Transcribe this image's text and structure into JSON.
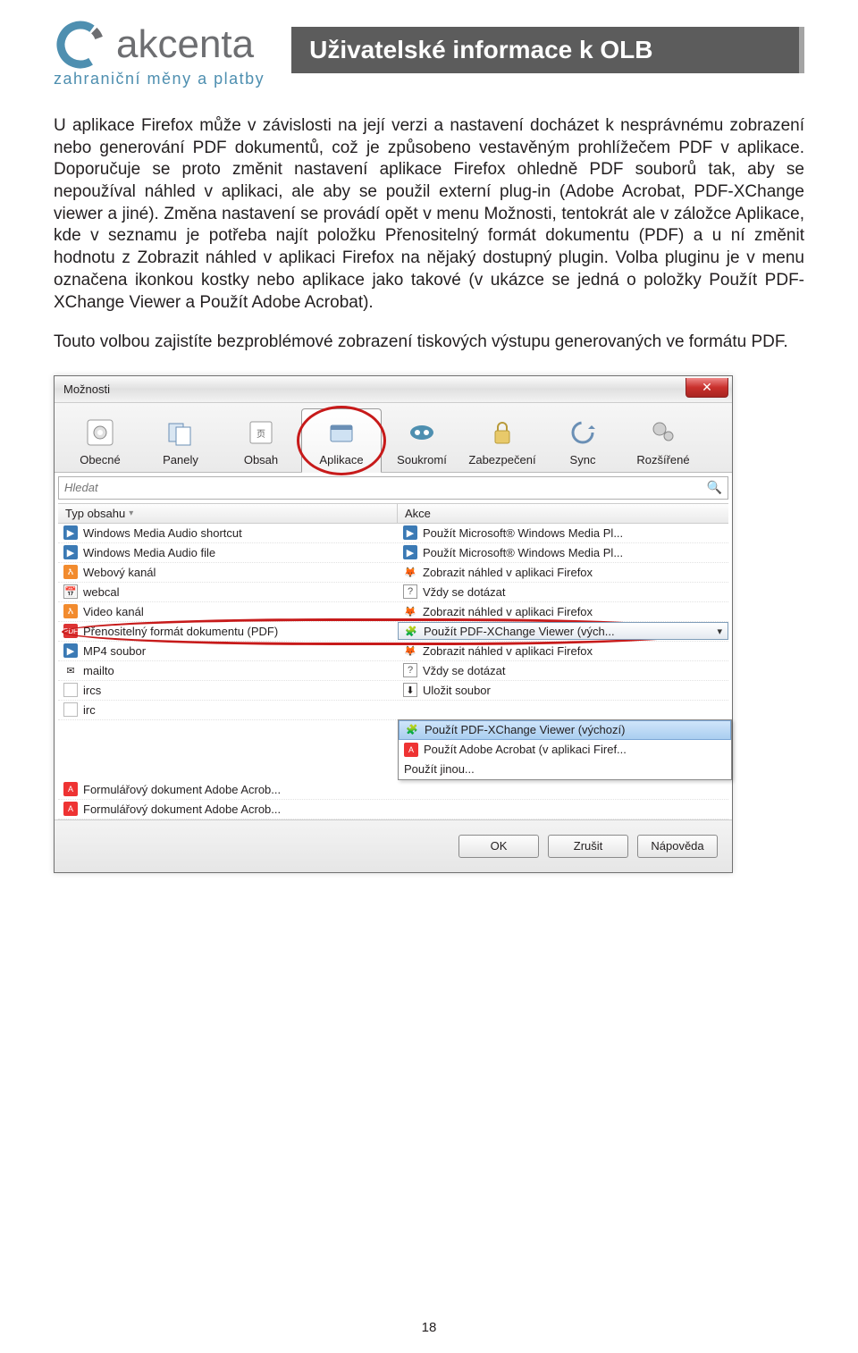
{
  "logo": {
    "word": "akcenta",
    "tagline": "zahraniční měny a platby"
  },
  "page_title": "Uživatelské informace k OLB",
  "paragraph1": "U aplikace Firefox může v závislosti na její verzi a nastavení docházet k nesprávnému zobrazení nebo generování PDF dokumentů, což je způsobeno vestavěným prohlížečem PDF v aplikace. Doporučuje se proto změnit nastavení aplikace Firefox ohledně PDF souborů tak, aby se nepoužíval náhled v aplikaci, ale aby se použil externí plug-in (Adobe Acrobat, PDF-XChange viewer a jiné). Změna nastavení se provádí opět v menu Možnosti, tentokrát ale v záložce Aplikace, kde v seznamu je potřeba najít položku Přenositelný formát dokumentu (PDF) a u ní změnit hodnotu z Zobrazit náhled v aplikaci Firefox na nějaký dostupný plugin. Volba pluginu je v menu označena ikonkou kostky nebo aplikace jako takové (v ukázce se jedná o položky Použít PDF-XChange Viewer a Použít Adobe Acrobat).",
  "paragraph2": "Touto volbou zajistíte bezproblémové zobrazení tiskových výstupu generovaných ve formátu PDF.",
  "dialog": {
    "title": "Možnosti",
    "close": "✕",
    "toolbar": [
      {
        "label": "Obecné",
        "icon": "gear"
      },
      {
        "label": "Panely",
        "icon": "panels"
      },
      {
        "label": "Obsah",
        "icon": "content"
      },
      {
        "label": "Aplikace",
        "icon": "apps",
        "selected": true
      },
      {
        "label": "Soukromí",
        "icon": "mask"
      },
      {
        "label": "Zabezpečení",
        "icon": "lock"
      },
      {
        "label": "Sync",
        "icon": "sync"
      },
      {
        "label": "Rozšířené",
        "icon": "advanced"
      }
    ],
    "search_placeholder": "Hledat",
    "columns": {
      "type": "Typ obsahu",
      "action": "Akce"
    },
    "rows": [
      {
        "type": "Windows Media Audio shortcut",
        "action": "Použít Microsoft® Windows Media Pl...",
        "ticon": "wm",
        "aicon": "wm"
      },
      {
        "type": "Windows Media Audio file",
        "action": "Použít Microsoft® Windows Media Pl...",
        "ticon": "wm",
        "aicon": "wm"
      },
      {
        "type": "Webový kanál",
        "action": "Zobrazit náhled v aplikaci Firefox",
        "ticon": "rss",
        "aicon": "ff"
      },
      {
        "type": "webcal",
        "action": "Vždy se dotázat",
        "ticon": "cal",
        "aicon": "ask"
      },
      {
        "type": "Video kanál",
        "action": "Zobrazit náhled v aplikaci Firefox",
        "ticon": "rss",
        "aicon": "ff"
      },
      {
        "type": "Přenositelný formát dokumentu (PDF)",
        "action": "Použít PDF-XChange Viewer (vých...",
        "ticon": "pdf",
        "aicon": "plug",
        "active": true
      },
      {
        "type": "MP4 soubor",
        "action": "Zobrazit náhled v aplikaci Firefox",
        "ticon": "mp4",
        "aicon": "ff"
      },
      {
        "type": "mailto",
        "action": "Vždy se dotázat",
        "ticon": "mail",
        "aicon": "ask"
      },
      {
        "type": "ircs",
        "action": "Uložit soubor",
        "ticon": "gen",
        "aicon": "save"
      },
      {
        "type": "irc",
        "action": "",
        "ticon": "gen",
        "aicon": ""
      }
    ],
    "dropdown": [
      {
        "label": "Použít PDF-XChange Viewer (výchozí)",
        "icon": "plug",
        "sel": true
      },
      {
        "label": "Použít Adobe Acrobat (v aplikaci Firef...",
        "icon": "acro"
      },
      {
        "label": "Použít jinou...",
        "icon": ""
      }
    ],
    "rows_after": [
      {
        "type": "Formulářový dokument Adobe Acrob...",
        "action": "",
        "ticon": "acro"
      },
      {
        "type": "Formulářový dokument Adobe Acrob...",
        "action": "",
        "ticon": "acro"
      }
    ],
    "buttons": {
      "ok": "OK",
      "cancel": "Zrušit",
      "help": "Nápověda"
    }
  },
  "page_number": "18"
}
